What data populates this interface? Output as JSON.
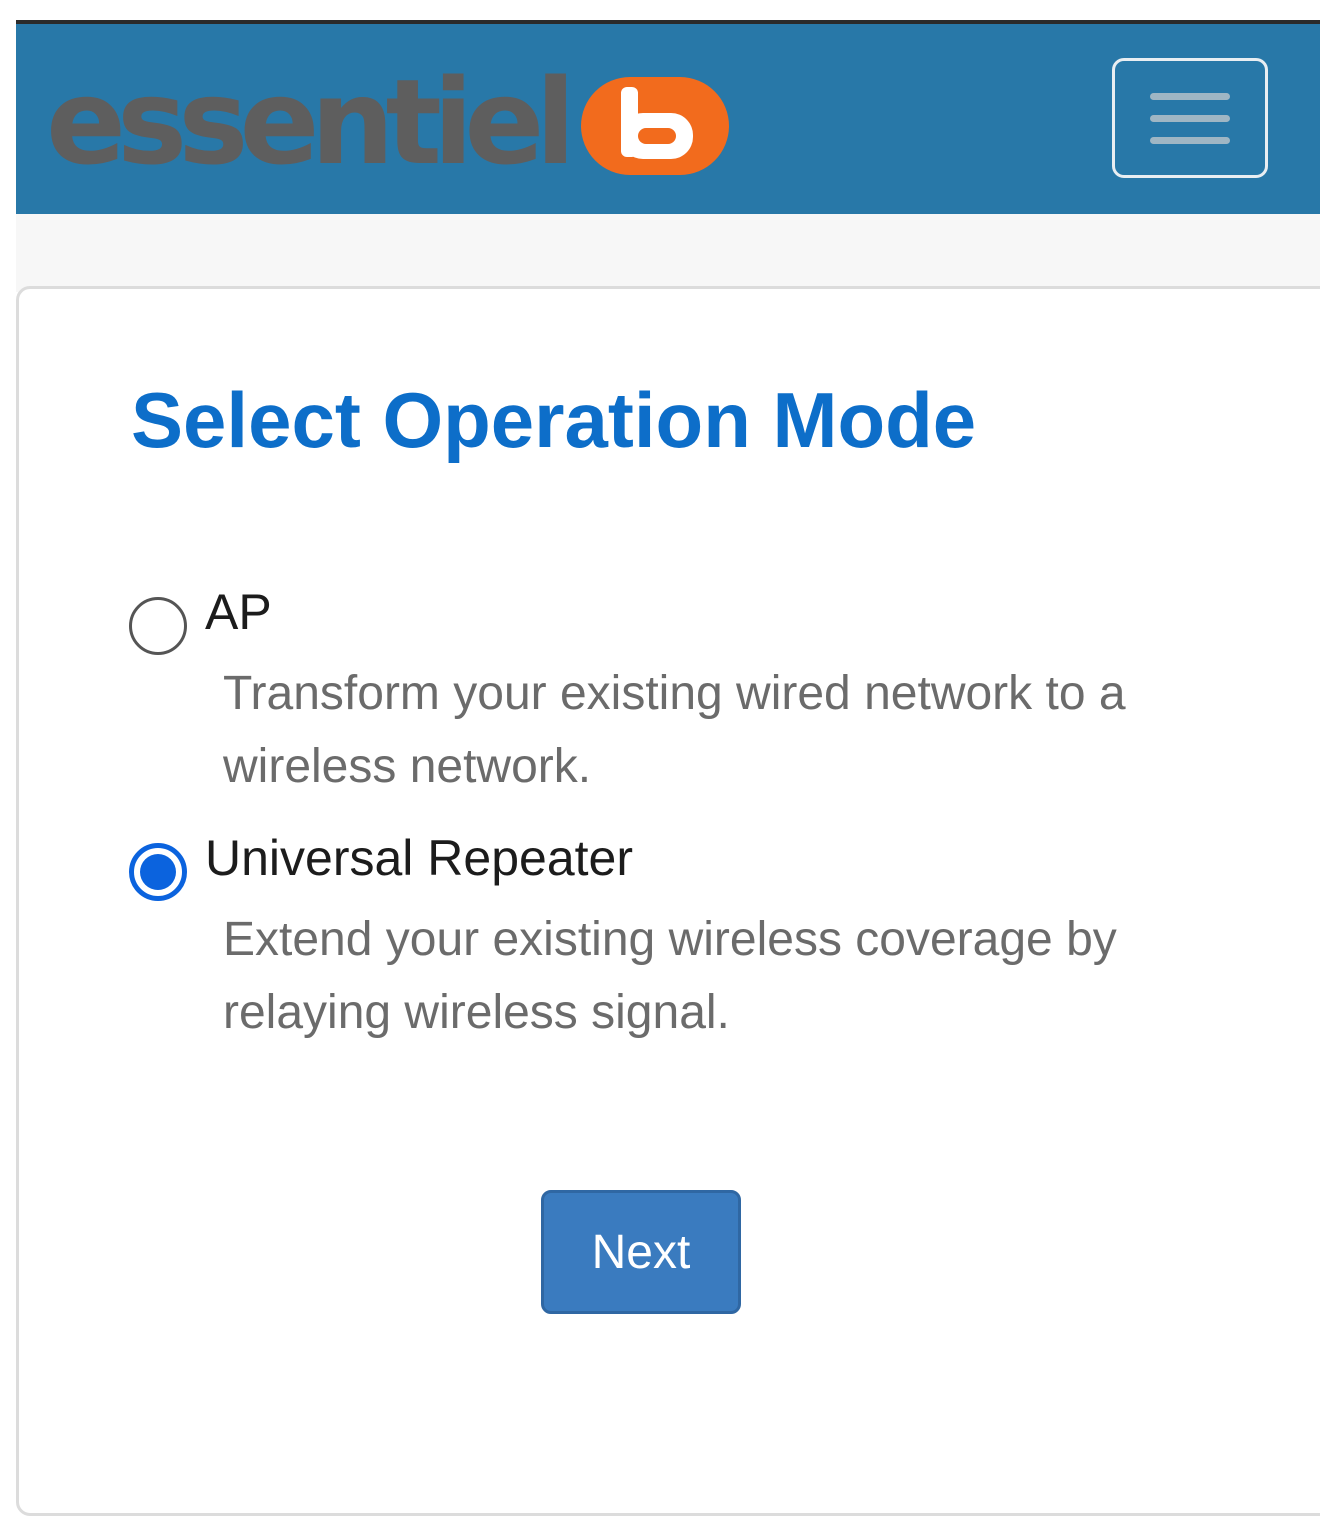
{
  "brand": {
    "logo_text": "essentiel",
    "logo_mark_color": "#f26b1d"
  },
  "colors": {
    "navbar_bg": "#2878a8",
    "title": "#0d6ec9",
    "radio_checked": "#0b63de",
    "button_bg": "#3a7bbf"
  },
  "navbar": {
    "menu_icon": "hamburger-menu-icon"
  },
  "page": {
    "title": "Select Operation Mode"
  },
  "options": [
    {
      "label": "AP",
      "description": "Transform your existing wired network to a wireless network.",
      "checked": false
    },
    {
      "label": "Universal Repeater",
      "description": "Extend your existing wireless coverage by relaying wireless signal.",
      "checked": true
    }
  ],
  "actions": {
    "next_label": "Next"
  }
}
